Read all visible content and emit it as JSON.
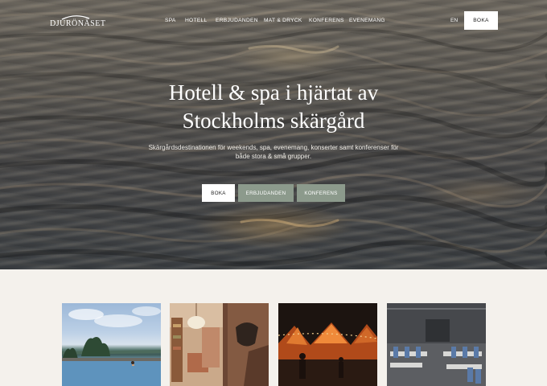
{
  "header": {
    "logo_text": "DJURÖNÄSET",
    "nav": [
      "SPA",
      "HOTELL",
      "ERBJUDANDEN",
      "MAT & DRYCK",
      "KONFERENS",
      "EVENEMANG"
    ],
    "language": "EN",
    "book_label": "BOKA"
  },
  "hero": {
    "headline_line1": "Hotell & spa i hjärtat av",
    "headline_line2": "Stockholms skärgård",
    "subtitle_line1": "Skärgårdsdestinationen för weekends, spa, evenemang, konserter samt konferenser för",
    "subtitle_line2": "både stora & små grupper.",
    "buttons": [
      "BOKA",
      "ERBJUDANDEN",
      "KONFERENS"
    ]
  },
  "cards": [
    "infinity-pool-card",
    "hotel-room-card",
    "concert-card",
    "conference-hall-card"
  ],
  "colors": {
    "sage": "#8c9a8c",
    "page_bg": "#f4f1ec"
  }
}
